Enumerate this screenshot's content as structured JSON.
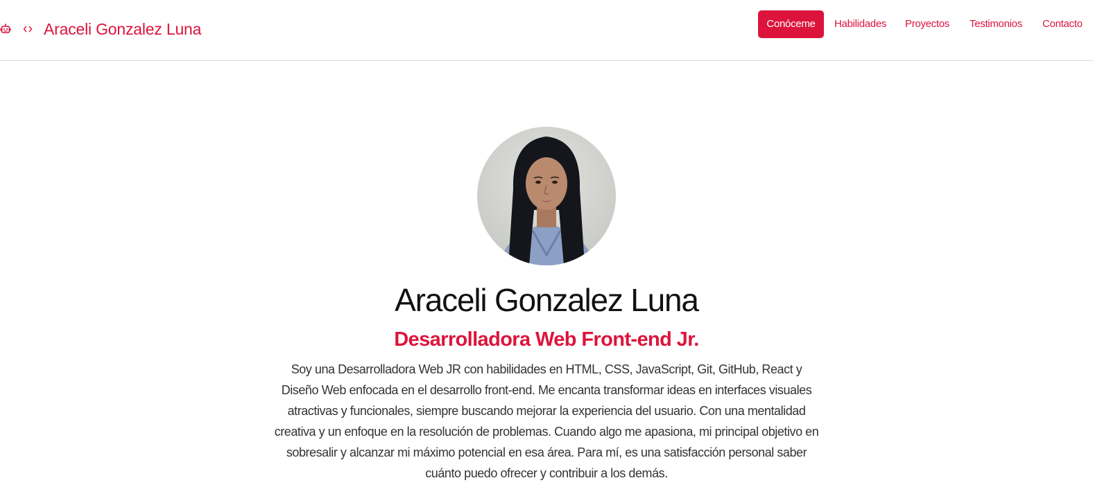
{
  "colors": {
    "accent": "#dc143c",
    "text_dark": "#111111",
    "text_body": "#333333",
    "background": "#ffffff",
    "divider": "#dddddd"
  },
  "header": {
    "brand_name": "Araceli Gonzalez Luna",
    "icons": [
      "robot-icon",
      "code-icon"
    ]
  },
  "nav": {
    "items": [
      {
        "label": "Conóceme",
        "active": true
      },
      {
        "label": "Habilidades",
        "active": false
      },
      {
        "label": "Proyectos",
        "active": false
      },
      {
        "label": "Testimonios",
        "active": false
      },
      {
        "label": "Contacto",
        "active": false
      }
    ]
  },
  "hero": {
    "name": "Araceli Gonzalez Luna",
    "role": "Desarrolladora Web Front-end Jr.",
    "bio": "Soy una Desarrolladora Web JR con habilidades en HTML, CSS, JavaScript, Git, GitHub, React y Diseño Web enfocada en el desarrollo front-end. Me encanta transformar ideas en interfaces visuales atractivas y funcionales, siempre buscando mejorar la experiencia del usuario. Con una mentalidad creativa y un enfoque en la resolución de problemas. Cuando algo me apasiona, mi principal objetivo en sobresalir y alcanzar mi máximo potencial en esa área. Para mí, es una satisfacción personal saber cuánto puedo ofrecer y contribuir a los demás."
  }
}
